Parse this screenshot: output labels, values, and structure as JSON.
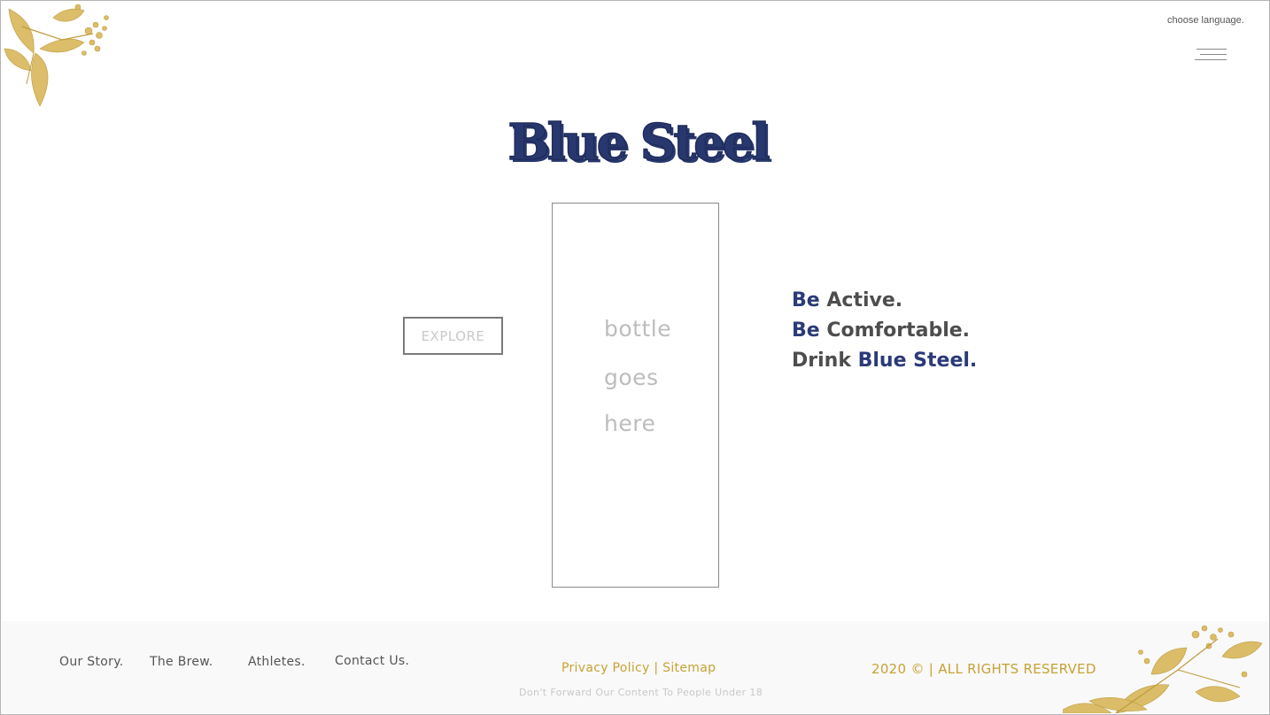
{
  "header": {
    "language_label": "choose language.",
    "menu_icon": "hamburger-menu-icon"
  },
  "hero": {
    "logo_text": "Blue Steel",
    "explore_label": "EXPLORE",
    "bottle_placeholder": [
      "bottle",
      "goes",
      "here"
    ],
    "tagline": {
      "line1_accent": "Be",
      "line1_rest": "Active.",
      "line2_accent": "Be",
      "line2_rest": "Comfortable.",
      "line3_rest": "Drink",
      "line3_accent": "Blue Steel."
    }
  },
  "footer": {
    "nav": [
      "Our Story.",
      "The Brew.",
      "Athletes.",
      "Contact Us."
    ],
    "privacy_label": "Privacy Policy",
    "separator": "|",
    "sitemap_label": "Sitemap",
    "warning": "Don't Forward Our Content To People Under 18",
    "copyright": "2020 © | ALL RIGHTS RESERVED"
  },
  "colors": {
    "brand_blue": "#2b3a78",
    "gold": "#c8a235",
    "text_gray": "#4d4d4d"
  }
}
